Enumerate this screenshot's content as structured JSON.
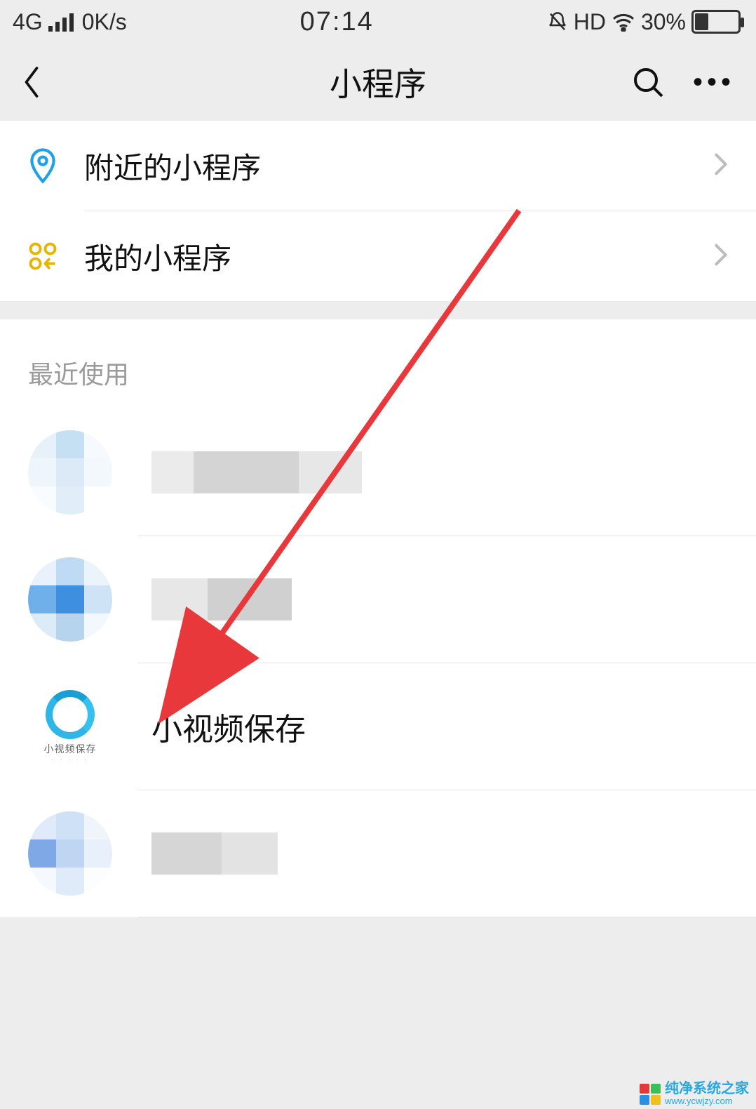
{
  "status": {
    "network_type": "4G",
    "speed": "0K/s",
    "time": "07:14",
    "hd_label": "HD",
    "battery_pct": "30%",
    "battery_fill": 30
  },
  "nav": {
    "title": "小程序"
  },
  "menu": {
    "nearby_label": "附近的小程序",
    "mine_label": "我的小程序"
  },
  "recent": {
    "header": "最近使用",
    "items": [
      {
        "name": "",
        "avatar_variant": "avatar1",
        "blurred": true
      },
      {
        "name": "",
        "avatar_variant": "avatar2",
        "blurred": true
      },
      {
        "name": "小视频保存",
        "avatar_variant": "mp-logo",
        "caption": "小视频保存",
        "blurred": false
      },
      {
        "name": "",
        "avatar_variant": "avatar4",
        "blurred": true
      }
    ]
  },
  "watermark": {
    "line1": "纯净系统之家",
    "line2": "www.ycwjzy.com"
  }
}
